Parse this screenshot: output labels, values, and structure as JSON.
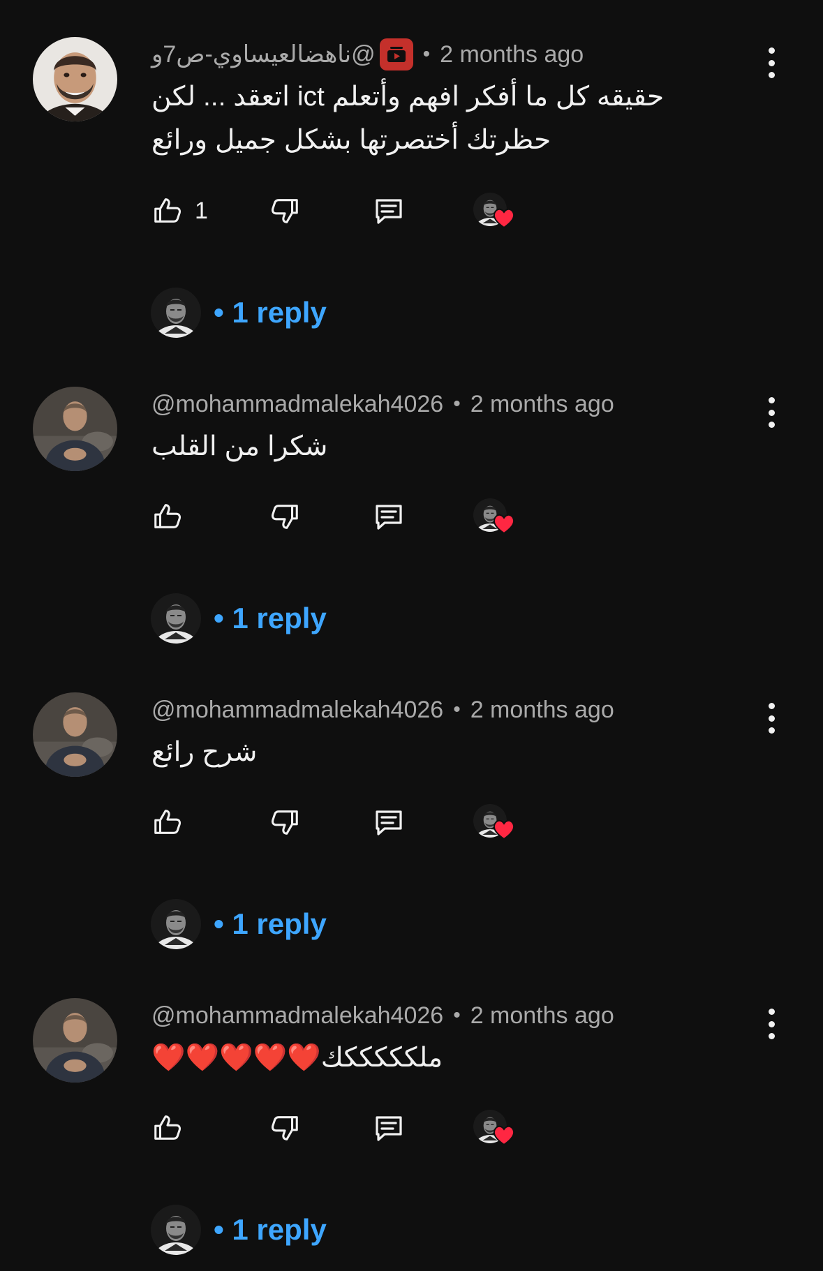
{
  "comments": [
    {
      "author": "@ناهضالعيساوي-ص7و",
      "is_owner_badge": true,
      "time": "2 months ago",
      "text": "حقيقه كل ما أفكر افهم وأتعلم ict  اتعقد ... لكن حظرتك أختصرتها بشكل جميل ورائع",
      "likes": "1",
      "replies_label": "1 reply"
    },
    {
      "author": "@mohammadmalekah4026",
      "is_owner_badge": false,
      "time": "2 months ago",
      "text": "شكرا من القلب",
      "likes": "",
      "replies_label": "1 reply"
    },
    {
      "author": "@mohammadmalekah4026",
      "is_owner_badge": false,
      "time": "2 months ago",
      "text": "شرح رائع",
      "likes": "",
      "replies_label": "1 reply"
    },
    {
      "author": "@mohammadmalekah4026",
      "is_owner_badge": false,
      "time": "2 months ago",
      "text": "ملكككككك❤️❤️❤️❤️❤️",
      "likes": "",
      "replies_label": "1 reply"
    }
  ],
  "separator": "•",
  "icons": {
    "like": "thumbs-up-icon",
    "dislike": "thumbs-down-icon",
    "reply": "comment-icon",
    "heart": "heart-icon",
    "more": "more-vertical-icon",
    "owner": "youtube-channel-badge-icon"
  },
  "colors": {
    "background": "#0f0f0f",
    "primary_text": "#f1f1f1",
    "secondary_text": "#aaaaaa",
    "reply_link": "#3ea6ff",
    "heart": "#ff2742",
    "owner_badge": "#c4302b"
  }
}
